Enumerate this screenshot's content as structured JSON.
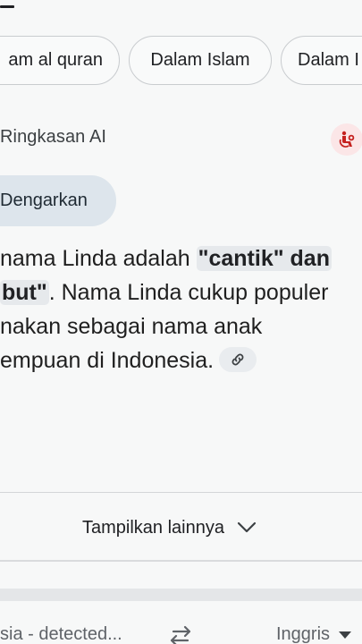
{
  "chips": [
    {
      "label": "am al quran"
    },
    {
      "label": "Dalam Islam"
    },
    {
      "label": "Dalam I"
    }
  ],
  "ai_overview": {
    "title": "Ringkasan AI",
    "listen_label": "Dengarkan",
    "summary": {
      "line1_pre": "nama Linda adalah ",
      "line1_highlight": "\"cantik\" dan",
      "line2_highlight": "but\"",
      "line2_post": ". Nama Linda cukup populer",
      "line3": "nakan sebagai nama anak",
      "line4": "empuan di Indonesia."
    },
    "show_more_label": "Tampilkan lainnya"
  },
  "translate": {
    "source_language": "sia - detected...",
    "target_language": "Inggris"
  },
  "icons": {
    "lab": "lab-flask-icon",
    "link": "link-icon",
    "chevron": "chevron-down-icon",
    "swap": "swap-arrows-icon",
    "dropdown": "dropdown-triangle-icon"
  },
  "colors": {
    "chip_border": "#c9cccf",
    "listen_bg": "#dde5ec",
    "highlight_bg": "#e6e9ec",
    "lab_icon": "#c5221f",
    "accent_link": "#1a73e8"
  }
}
